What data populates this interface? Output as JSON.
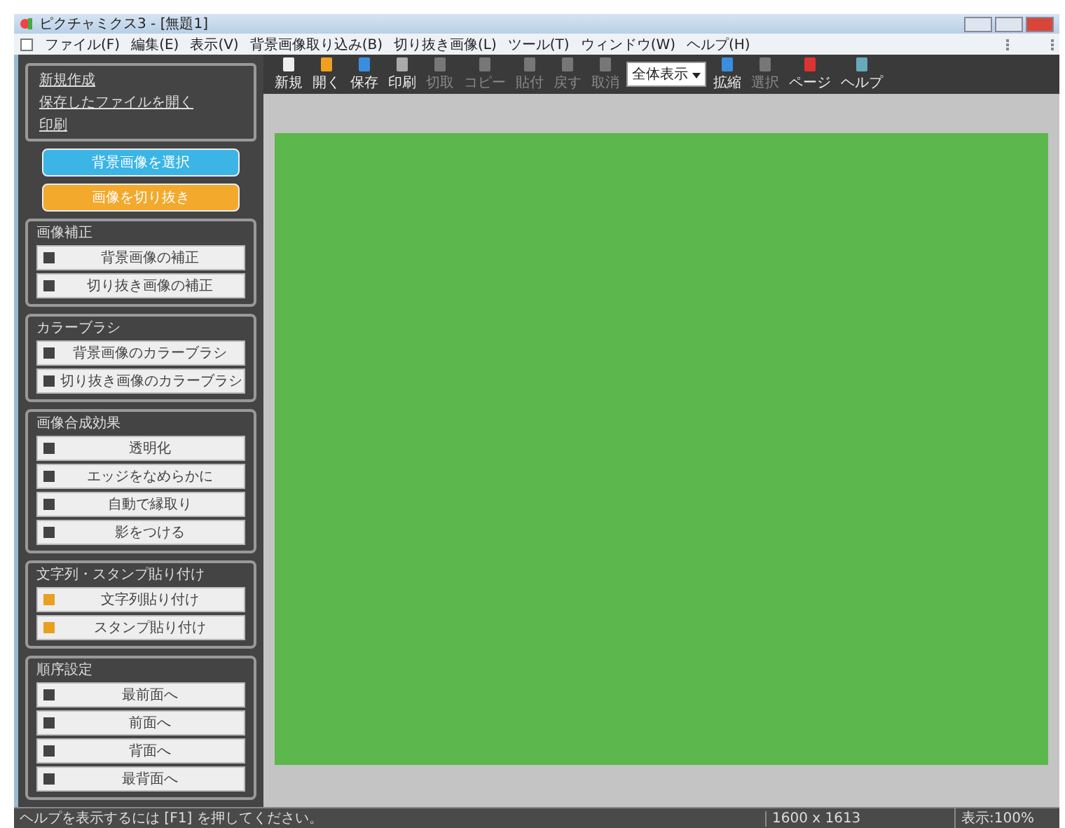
{
  "window": {
    "title": "ピクチャミクス3 - [無題1]"
  },
  "menu": [
    "ファイル(F)",
    "編集(E)",
    "表示(V)",
    "背景画像取り込み(B)",
    "切り抜き画像(L)",
    "ツール(T)",
    "ウィンドウ(W)",
    "ヘルプ(H)"
  ],
  "toolbar": [
    {
      "kind": "button",
      "label": "新規",
      "disabled": false
    },
    {
      "kind": "button",
      "label": "開く",
      "disabled": false
    },
    {
      "kind": "button",
      "label": "保存",
      "disabled": false
    },
    {
      "kind": "button",
      "label": "印刷",
      "disabled": false
    },
    {
      "kind": "button",
      "label": "切取",
      "disabled": true
    },
    {
      "kind": "button",
      "label": "コピー",
      "disabled": true
    },
    {
      "kind": "button",
      "label": "貼付",
      "disabled": true
    },
    {
      "kind": "button",
      "label": "戻す",
      "disabled": true
    },
    {
      "kind": "button",
      "label": "取消",
      "disabled": true
    },
    {
      "kind": "dropdown",
      "label": "全体表示",
      "disabled": false
    },
    {
      "kind": "button",
      "label": "拡縮",
      "disabled": false
    },
    {
      "kind": "button",
      "label": "選択",
      "disabled": true
    },
    {
      "kind": "button",
      "label": "ページ",
      "disabled": false
    },
    {
      "kind": "button",
      "label": "ヘルプ",
      "disabled": false
    }
  ],
  "file_links": [
    "新規作成",
    "保存したファイルを開く",
    "印刷"
  ],
  "main_buttons": [
    {
      "label": "背景画像を選択",
      "color": "#3bb4e6"
    },
    {
      "label": "画像を切り抜き",
      "color": "#f2a92c"
    }
  ],
  "groups": [
    {
      "title": "画像補正",
      "items": [
        "背景画像の補正",
        "切り抜き画像の補正"
      ]
    },
    {
      "title": "カラーブラシ",
      "items": [
        "背景画像のカラーブラシ",
        "切り抜き画像のカラーブラシ"
      ]
    },
    {
      "title": "画像合成効果",
      "items": [
        "透明化",
        "エッジをなめらかに",
        "自動で縁取り",
        "影をつける"
      ]
    },
    {
      "title": "文字列・スタンプ貼り付け",
      "items": [
        "文字列貼り付け",
        "スタンプ貼り付け"
      ]
    },
    {
      "title": "順序設定",
      "items": [
        "最前面へ",
        "前面へ",
        "背面へ",
        "最背面へ"
      ]
    }
  ],
  "status_bar": {
    "message": "ヘルプを表示するには [F1] を押してください。",
    "size": "1600 x 1613",
    "zoom": "表示:100%"
  }
}
